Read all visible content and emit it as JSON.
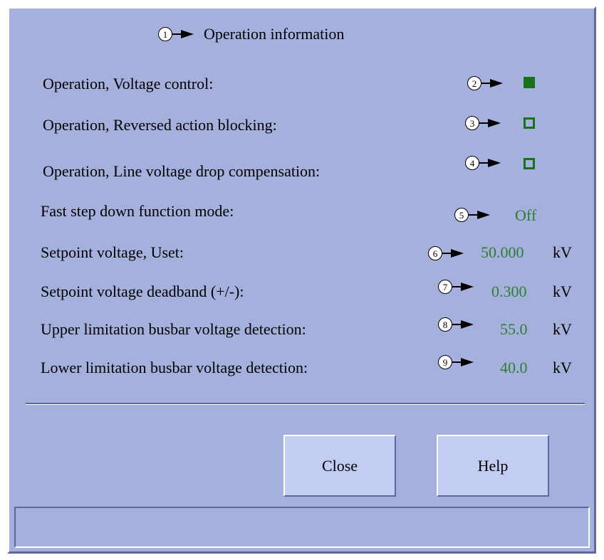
{
  "dialog": {
    "title": "Operation information",
    "title_callout": "1"
  },
  "rows": [
    {
      "label": "Operation, Voltage control:",
      "callout": "2",
      "indicator": "filled"
    },
    {
      "label": "Operation, Reversed action blocking:",
      "callout": "3",
      "indicator": "empty"
    },
    {
      "label": "Operation, Line voltage drop compensation:",
      "callout": "4",
      "indicator": "empty"
    },
    {
      "label": "Fast step down function mode:",
      "callout": "5",
      "value": "Off"
    },
    {
      "label": "Setpoint voltage, Uset:",
      "callout": "6",
      "value": "50.000",
      "unit": "kV"
    },
    {
      "label": "Setpoint voltage deadband (+/-):",
      "callout": "7",
      "value": "0.300",
      "unit": "kV"
    },
    {
      "label": "Upper limitation busbar voltage detection:",
      "callout": "8",
      "value": "55.0",
      "unit": "kV"
    },
    {
      "label": "Lower limitation busbar voltage detection:",
      "callout": "9",
      "value": "40.0",
      "unit": "kV"
    }
  ],
  "buttons": {
    "close": "Close",
    "help": "Help"
  },
  "colors": {
    "panel_background": "#a6b0dc",
    "button_background": "#c3ccf2",
    "value_green": "#2e7d32",
    "indicator_green": "#187018"
  },
  "icons": {
    "callout": "numbered-callout-arrow",
    "indicator_on": "filled-square-indicator",
    "indicator_off": "empty-square-indicator"
  }
}
